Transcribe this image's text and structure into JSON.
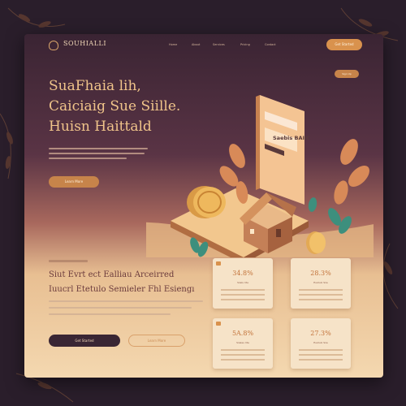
{
  "brand": {
    "name": "SOUHIALLI"
  },
  "nav": {
    "links": [
      "Home",
      "About",
      "Services",
      "Pricing",
      "Contact"
    ],
    "cta": "Get Started"
  },
  "hero": {
    "title_lines": [
      "SuaFhaiа lih,",
      "Caiciaig Sue Siille.",
      "Huisn Haittald"
    ],
    "button": "Learn More",
    "pill": "Sign Up"
  },
  "board": {
    "title": "Saebis BAIIC"
  },
  "section": {
    "title_lines": [
      "Siut Evrt ect Ealliau Arceirred",
      "Iuucrl Etetulo Semieler Fhl Esiengı"
    ],
    "primary_button": "Get Started",
    "secondary_button": "Learn More"
  },
  "cards": [
    {
      "value": "34.8%",
      "label": "Siielu Iite"
    },
    {
      "value": "28.3%",
      "label": "Eustulo Siie"
    },
    {
      "value": "5A.8%",
      "label": "Siieleu Iite"
    },
    {
      "value": "27.3%",
      "label": "Eustulo Siie"
    }
  ],
  "colors": {
    "accent": "#d9924d",
    "dark": "#3a2634",
    "title_gold": "#f0c48a",
    "section_title": "#6a3a3c"
  }
}
